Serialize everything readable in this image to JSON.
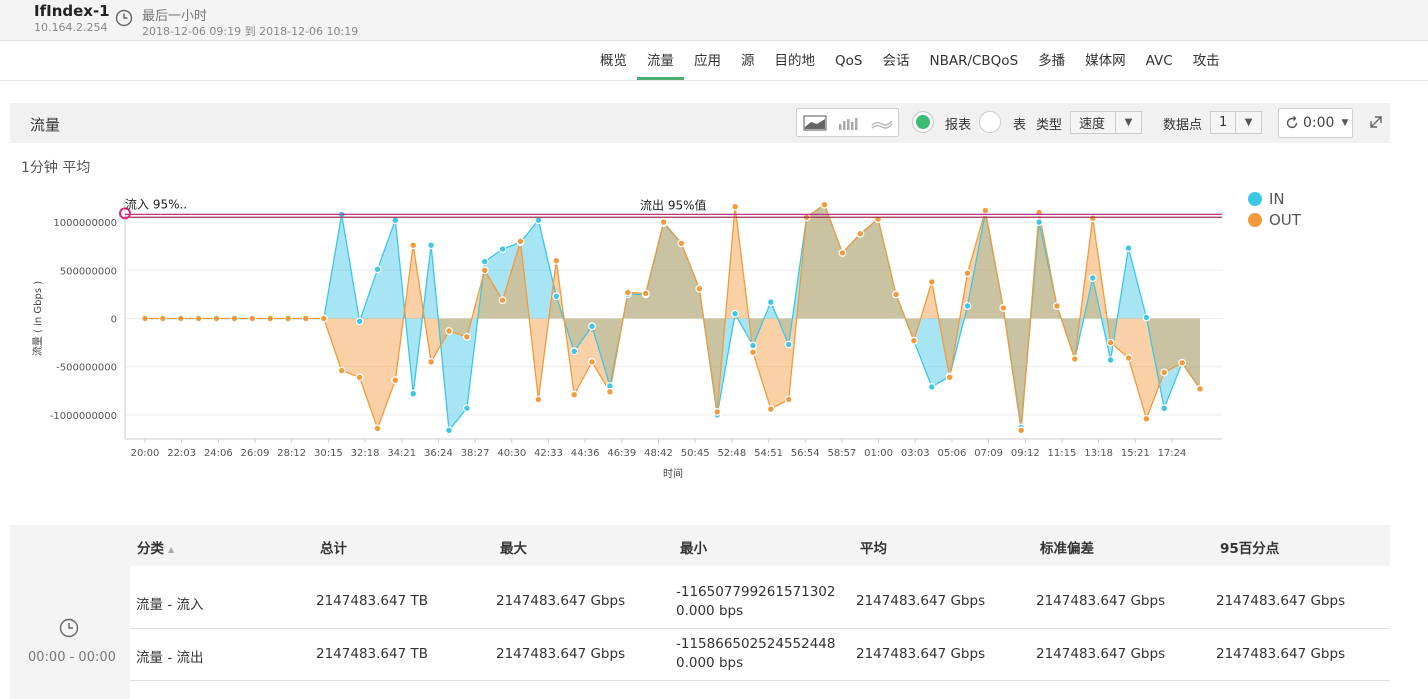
{
  "device": {
    "name": "IfIndex-1",
    "ip": "10.164.2.254"
  },
  "time": {
    "title": "最后一小时",
    "range": "2018-12-06 09:19 到 2018-12-06 10:19"
  },
  "tabs": [
    {
      "label": "概览",
      "active": false
    },
    {
      "label": "流量",
      "active": true
    },
    {
      "label": "应用",
      "active": false
    },
    {
      "label": "源",
      "active": false
    },
    {
      "label": "目的地",
      "active": false
    },
    {
      "label": "QoS",
      "active": false
    },
    {
      "label": "会话",
      "active": false
    },
    {
      "label": "NBAR/CBQoS",
      "active": false
    },
    {
      "label": "多播",
      "active": false
    },
    {
      "label": "媒体网",
      "active": false
    },
    {
      "label": "AVC",
      "active": false
    },
    {
      "label": "攻击",
      "active": false
    }
  ],
  "panel": {
    "title": "流量",
    "report_label": "报表",
    "table_label": "表",
    "type_label": "类型",
    "type_value": "速度",
    "points_label": "数据点",
    "points_value": "1",
    "refresh_value": "0:00",
    "chart_types": [
      "area-chart-icon",
      "bar-chart-icon",
      "stacked-area-icon"
    ]
  },
  "subtitle": "1分钟 平均",
  "chart_data": {
    "type": "area",
    "ylabel": "流量 ( in Gbps )",
    "xlabel": "时间",
    "ylim": [
      -1250000000,
      1250000000
    ],
    "yticks": [
      1000000000,
      500000000,
      0,
      -500000000,
      -1000000000
    ],
    "xtick_labels": [
      "20:00",
      "22:03",
      "24:06",
      "26:09",
      "28:12",
      "30:15",
      "32:18",
      "34:21",
      "36:24",
      "38:27",
      "40:30",
      "42:33",
      "44:36",
      "46:39",
      "48:42",
      "50:45",
      "52:48",
      "54:51",
      "56:54",
      "58:57",
      "01:00",
      "03:03",
      "05:06",
      "07:09",
      "09:12",
      "11:15",
      "13:18",
      "15:21",
      "17:24"
    ],
    "reference_lines": [
      {
        "label": "流入 95%..",
        "value": 1080000000
      },
      {
        "label": "流出 95%值",
        "value": 1050000000
      }
    ],
    "series": [
      {
        "name": "IN",
        "color": "#3ec6e6",
        "values": [
          0,
          0,
          0,
          0,
          0,
          0,
          0,
          0,
          0,
          0,
          0,
          1080000000,
          -30000000,
          510000000,
          1020000000,
          -780000000,
          760000000,
          -1160000000,
          -930000000,
          590000000,
          720000000,
          790000000,
          1020000000,
          230000000,
          -340000000,
          -80000000,
          -700000000,
          250000000,
          250000000,
          990000000,
          780000000,
          310000000,
          -1000000000,
          50000000,
          -280000000,
          170000000,
          -270000000,
          1050000000,
          1180000000,
          680000000,
          880000000,
          1030000000,
          250000000,
          -230000000,
          -710000000,
          -600000000,
          130000000,
          1100000000,
          110000000,
          -1130000000,
          1000000000,
          130000000,
          -420000000,
          420000000,
          -430000000,
          730000000,
          10000000,
          -930000000,
          -460000000,
          -730000000
        ]
      },
      {
        "name": "OUT",
        "color": "#f39a3c",
        "values": [
          0,
          0,
          0,
          0,
          0,
          0,
          0,
          0,
          0,
          0,
          0,
          -540000000,
          -610000000,
          -1140000000,
          -640000000,
          760000000,
          -450000000,
          -130000000,
          -190000000,
          500000000,
          190000000,
          800000000,
          -840000000,
          600000000,
          -790000000,
          -450000000,
          -760000000,
          270000000,
          260000000,
          1000000000,
          780000000,
          310000000,
          -970000000,
          1160000000,
          -350000000,
          -940000000,
          -840000000,
          1050000000,
          1180000000,
          680000000,
          880000000,
          1030000000,
          250000000,
          -230000000,
          380000000,
          -610000000,
          470000000,
          1120000000,
          110000000,
          -1160000000,
          1100000000,
          130000000,
          -420000000,
          1040000000,
          -250000000,
          -410000000,
          -1040000000,
          -560000000,
          -460000000,
          -730000000
        ]
      }
    ]
  },
  "legend": [
    {
      "label": "IN",
      "color": "#3ec6e6"
    },
    {
      "label": "OUT",
      "color": "#f39a3c"
    }
  ],
  "table": {
    "headers": [
      "分类",
      "总计",
      "最大",
      "最小",
      "平均",
      "标准偏差",
      "95百分点"
    ],
    "side_time": "00:00 - 00:00",
    "rows": [
      [
        "流量 - 流入",
        "2147483.647 TB",
        "2147483.647 Gbps",
        "-1165077992615713020.000 bps",
        "2147483.647 Gbps",
        "2147483.647 Gbps",
        "2147483.647 Gbps"
      ],
      [
        "流量 - 流出",
        "2147483.647 TB",
        "2147483.647 Gbps",
        "-1158665025245524480.000 bps",
        "2147483.647 Gbps",
        "2147483.647 Gbps",
        "2147483.647 Gbps"
      ]
    ]
  }
}
